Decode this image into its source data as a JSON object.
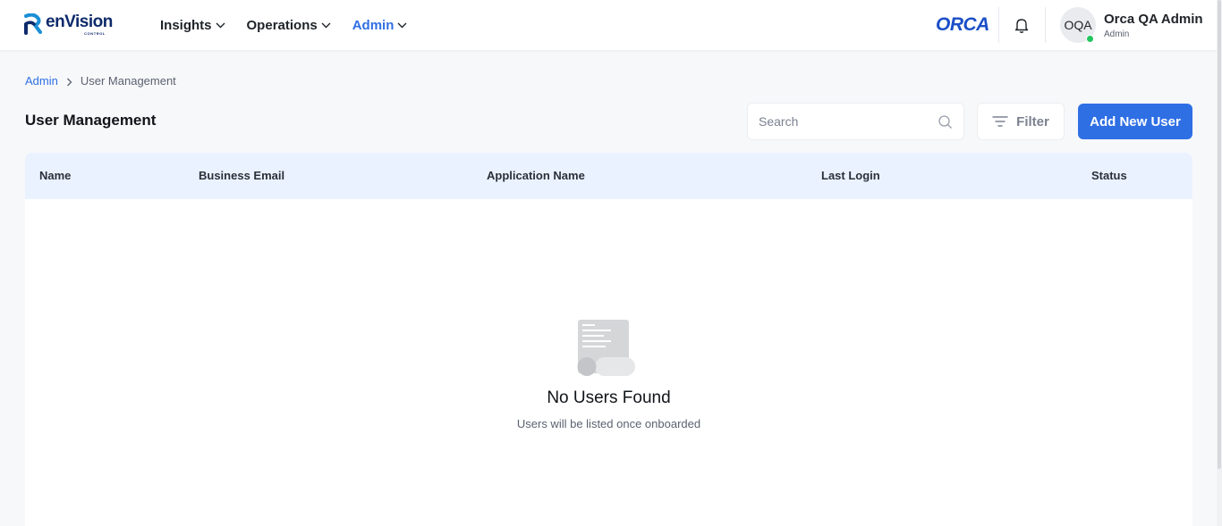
{
  "brand": {
    "logo_text": "enVision",
    "logo_sub": "CONTROL",
    "partner_logo": "ORCA",
    "colors": {
      "primary": "#2f6fe4",
      "navy": "#0d2a6b",
      "online": "#22c55e"
    }
  },
  "nav": {
    "items": [
      {
        "label": "Insights",
        "icon": "chevron-down-icon",
        "active": false
      },
      {
        "label": "Operations",
        "icon": "chevron-down-icon",
        "active": false
      },
      {
        "label": "Admin",
        "icon": "chevron-down-icon",
        "active": true
      }
    ]
  },
  "header": {
    "notification_icon": "bell-icon",
    "user": {
      "initials": "OQA",
      "name": "Orca QA Admin",
      "role": "Admin",
      "status": "online"
    }
  },
  "breadcrumb": {
    "parent": "Admin",
    "current": "User Management"
  },
  "page": {
    "title": "User Management"
  },
  "toolbar": {
    "search_placeholder": "Search",
    "search_value": "",
    "filter_label": "Filter",
    "add_label": "Add New User"
  },
  "table": {
    "columns": [
      "Name",
      "Business Email",
      "Application Name",
      "Last Login",
      "Status"
    ],
    "rows": []
  },
  "empty_state": {
    "icon": "empty-document-icon",
    "title": "No Users Found",
    "subtitle": "Users will be listed once onboarded"
  }
}
